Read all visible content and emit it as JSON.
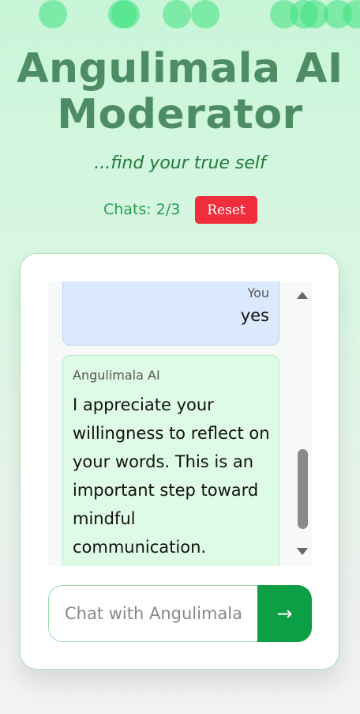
{
  "header": {
    "title": "Angulimala AI Moderator",
    "tagline": "...find your true self"
  },
  "status": {
    "chats_label": "Chats: 2/3",
    "reset_label": "Reset"
  },
  "messages": [
    {
      "sender": "You",
      "text": "yes"
    },
    {
      "sender": "Angulimala AI",
      "text": "I appreciate your willingness to reflect on your words. This is an important step toward mindful communication."
    }
  ],
  "composer": {
    "placeholder": "Chat with Angulimala AI",
    "send_icon": "→"
  },
  "colors": {
    "accent_green": "#0d9f45",
    "reset_red": "#f02d3a",
    "title_green": "#4e8d64"
  }
}
